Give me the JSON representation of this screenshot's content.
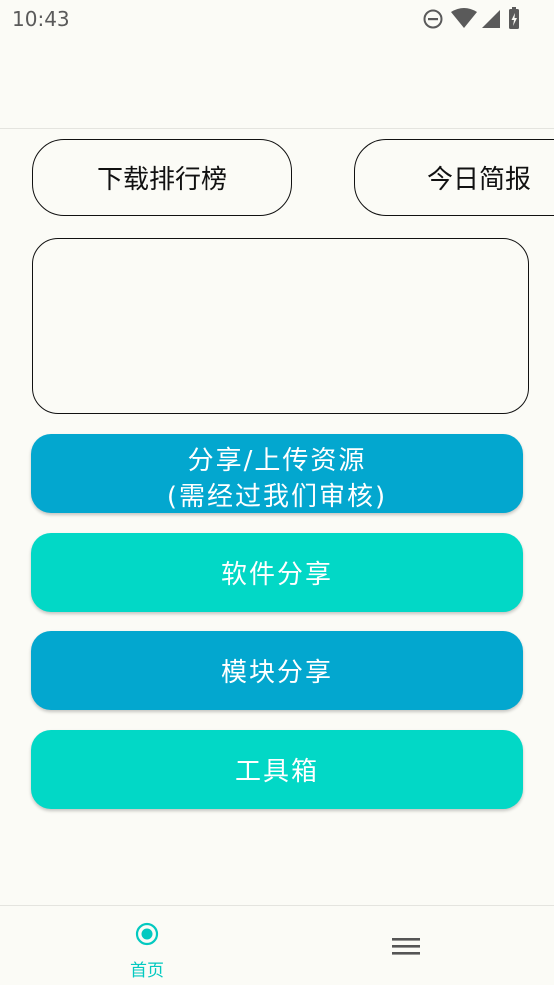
{
  "status_bar": {
    "time": "10:43",
    "icons": [
      "do-not-disturb-icon",
      "wifi-icon",
      "cellular-signal-icon",
      "battery-charging-icon"
    ]
  },
  "chips": {
    "ranking_label": "下载排行榜",
    "daily_label": "今日简报"
  },
  "buttons": {
    "upload_line1": "分享/上传资源",
    "upload_line2": "(需经过我们审核)",
    "software_label": "软件分享",
    "module_label": "模块分享",
    "toolbox_label": "工具箱"
  },
  "bottom_nav": {
    "home_label": "首页",
    "menu_icon": "hamburger-menu-icon"
  },
  "colors": {
    "background": "#fbfbf6",
    "blue_button": "#03a7cf",
    "teal_button": "#02d8c6",
    "nav_active": "#03c9c0",
    "nav_inactive": "#555555"
  }
}
